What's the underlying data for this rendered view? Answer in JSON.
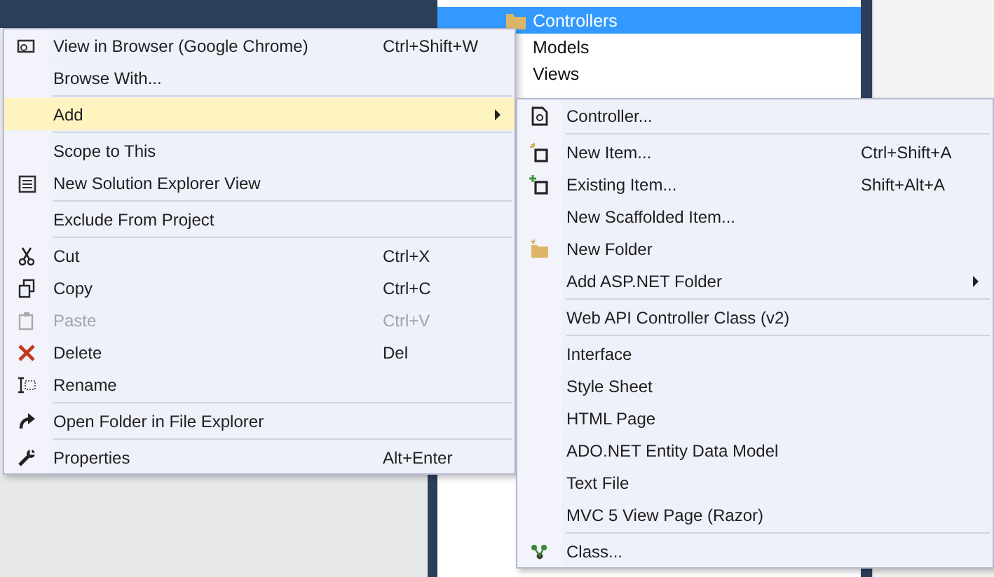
{
  "tree": {
    "items": [
      {
        "label": "Controllers",
        "selected": true
      },
      {
        "label": "Models",
        "selected": false
      },
      {
        "label": "Views",
        "selected": false
      }
    ]
  },
  "context_menu": {
    "sections": [
      [
        {
          "label": "View in Browser (Google Chrome)",
          "shortcut": "Ctrl+Shift+W",
          "kind": "browser",
          "selected": false,
          "disabled": false,
          "submenu": false
        },
        {
          "label": "Browse With...",
          "selected": false,
          "disabled": false,
          "submenu": false
        }
      ],
      [
        {
          "label": "Add",
          "selected": true,
          "disabled": false,
          "submenu": true
        }
      ],
      [
        {
          "label": "Scope to This",
          "selected": false,
          "disabled": false,
          "submenu": false
        },
        {
          "label": "New Solution Explorer View",
          "kind": "window",
          "selected": false,
          "disabled": false,
          "submenu": false
        }
      ],
      [
        {
          "label": "Exclude From Project",
          "selected": false,
          "disabled": false,
          "submenu": false
        }
      ],
      [
        {
          "label": "Cut",
          "shortcut": "Ctrl+X",
          "kind": "cut",
          "selected": false,
          "disabled": false,
          "submenu": false
        },
        {
          "label": "Copy",
          "shortcut": "Ctrl+C",
          "kind": "copy",
          "selected": false,
          "disabled": false,
          "submenu": false
        },
        {
          "label": "Paste",
          "shortcut": "Ctrl+V",
          "kind": "paste",
          "selected": false,
          "disabled": true,
          "submenu": false
        },
        {
          "label": "Delete",
          "shortcut": "Del",
          "kind": "delete",
          "selected": false,
          "disabled": false,
          "submenu": false
        },
        {
          "label": "Rename",
          "kind": "rename",
          "selected": false,
          "disabled": false,
          "submenu": false
        }
      ],
      [
        {
          "label": "Open Folder in File Explorer",
          "kind": "redo",
          "selected": false,
          "disabled": false,
          "submenu": false
        }
      ],
      [
        {
          "label": "Properties",
          "shortcut": "Alt+Enter",
          "kind": "wrench",
          "selected": false,
          "disabled": false,
          "submenu": false
        }
      ]
    ]
  },
  "add_submenu": {
    "sections": [
      [
        {
          "label": "Controller...",
          "kind": "controller",
          "selected": false,
          "disabled": false,
          "submenu": false
        }
      ],
      [
        {
          "label": "New Item...",
          "shortcut": "Ctrl+Shift+A",
          "kind": "new-item",
          "selected": false,
          "disabled": false,
          "submenu": false
        },
        {
          "label": "Existing Item...",
          "shortcut": "Shift+Alt+A",
          "kind": "existing-item",
          "selected": false,
          "disabled": false,
          "submenu": false
        },
        {
          "label": "New Scaffolded Item...",
          "selected": false,
          "disabled": false,
          "submenu": false
        },
        {
          "label": "New Folder",
          "kind": "folder",
          "selected": false,
          "disabled": false,
          "submenu": false
        },
        {
          "label": "Add ASP.NET Folder",
          "selected": false,
          "disabled": false,
          "submenu": true
        }
      ],
      [
        {
          "label": "Web API Controller Class (v2)",
          "selected": false,
          "disabled": false,
          "submenu": false
        }
      ],
      [
        {
          "label": "Interface",
          "selected": false,
          "disabled": false,
          "submenu": false
        },
        {
          "label": "Style Sheet",
          "selected": false,
          "disabled": false,
          "submenu": false
        },
        {
          "label": "HTML Page",
          "selected": false,
          "disabled": false,
          "submenu": false
        },
        {
          "label": "ADO.NET Entity Data Model",
          "selected": false,
          "disabled": false,
          "submenu": false
        },
        {
          "label": "Text File",
          "selected": false,
          "disabled": false,
          "submenu": false
        },
        {
          "label": "MVC 5 View Page (Razor)",
          "selected": false,
          "disabled": false,
          "submenu": false
        }
      ],
      [
        {
          "label": "Class...",
          "kind": "class",
          "selected": false,
          "disabled": false,
          "submenu": false
        }
      ]
    ]
  }
}
